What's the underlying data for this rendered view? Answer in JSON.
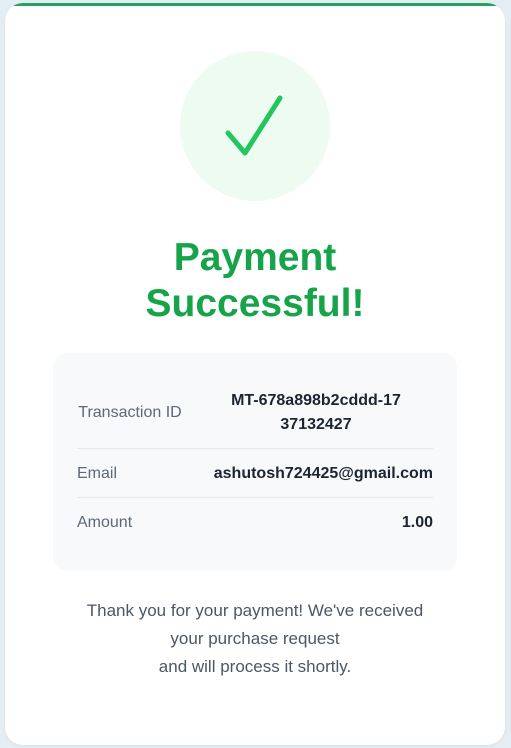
{
  "colors": {
    "accent": "#16a34a",
    "accent_bar": "#22a55a",
    "check_bg": "#edfbf1",
    "details_bg": "#f7f9fb",
    "page_bg": "#e3edf3"
  },
  "status_icon": "checkmark-icon",
  "title": "Payment Successful!",
  "details": {
    "transaction": {
      "label": "Transaction ID",
      "value": "MT-678a898b2cddd-1737132427"
    },
    "email": {
      "label": "Email",
      "value": "ashutosh724425@gmail.com"
    },
    "amount": {
      "label": "Amount",
      "value": "1.00"
    }
  },
  "message": {
    "line1": "Thank you for your payment! We've received",
    "line2": "your purchase request",
    "line3": "and will process it shortly."
  }
}
